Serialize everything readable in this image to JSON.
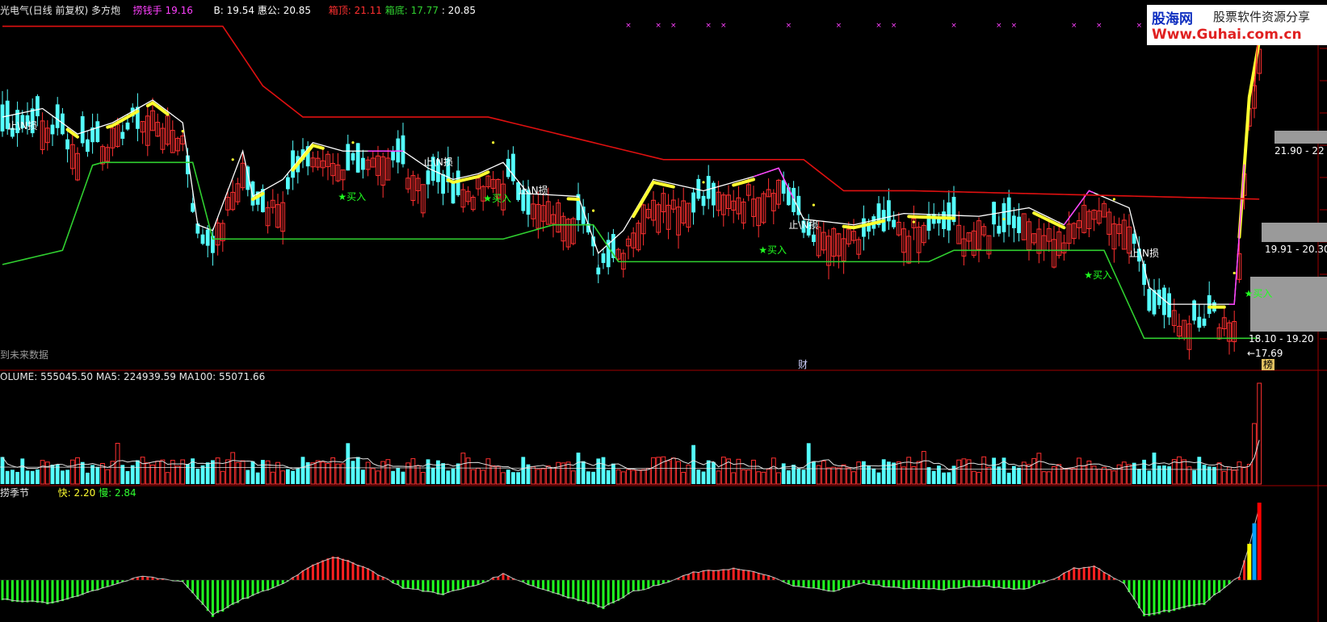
{
  "header": {
    "stock_name": "光电气(日线 前复权) 多方炮",
    "lao_label": "捞钱手",
    "lao_value": "19.16",
    "b_label": "B:",
    "b_value": "19.54",
    "hui_label": "惠公:",
    "hui_value": "20.85",
    "xd_label": "箱顶:",
    "xd_value": "21.11",
    "xdi_label": "箱底:",
    "xdi_value": "17.77",
    "extra_value": ": 20.85"
  },
  "logo": {
    "cn_name": "股海网",
    "slogan": "股票软件资源分享",
    "url": "Www.Guhai.com.cn"
  },
  "main_chart": {
    "future_note": "到未来数据",
    "cai_marker": "财",
    "bang_marker": "榜",
    "zone_upper": "21.90 - 22",
    "zone_mid": "19.91 - 20.30",
    "zone_lower": "18.10 - 19.20",
    "low_marker": "←17.69",
    "signals": [
      {
        "text": "止\\N损",
        "i": 1,
        "price": 21.7,
        "color": "#ffffff"
      },
      {
        "text": "止\\N损",
        "i": 84,
        "price": 21.05,
        "color": "#ffffff"
      },
      {
        "text": "止\\N损",
        "i": 103,
        "price": 20.55,
        "color": "#ffffff"
      },
      {
        "text": "止\\N损",
        "i": 157,
        "price": 19.95,
        "color": "#ffffff"
      },
      {
        "text": "止\\N损",
        "i": 225,
        "price": 19.45,
        "color": "#ffffff"
      },
      {
        "text": "★买入",
        "i": 67,
        "price": 20.45,
        "color": "#20ff20"
      },
      {
        "text": "★买入",
        "i": 96,
        "price": 20.42,
        "color": "#20ff20"
      },
      {
        "text": "★买入",
        "i": 151,
        "price": 19.5,
        "color": "#20ff20"
      },
      {
        "text": "★买入",
        "i": 216,
        "price": 19.07,
        "color": "#20ff20"
      },
      {
        "text": "★买入",
        "i": 248,
        "price": 18.73,
        "color": "#20ff20"
      }
    ]
  },
  "volume_panel": {
    "label": "OLUME:",
    "value": "555045.50",
    "ma5_label": "MA5:",
    "ma5_value": "224939.59",
    "ma100_label": "MA100:",
    "ma100_value": "55071.66"
  },
  "season_panel": {
    "name": "捞季节",
    "fast_label": "快:",
    "fast_value": "2.20",
    "slow_label": "慢:",
    "slow_value": "2.84"
  },
  "colors": {
    "up": "#ff3030",
    "down": "#54ffff",
    "box_top": "#e01010",
    "box_bottom": "#30d030",
    "yellow": "#ffff30",
    "magenta": "#ff40ff",
    "white": "#ffffff",
    "frame": "#a00000"
  },
  "chart_data": {
    "type": "candlestick",
    "price_range": [
      17.4,
      23.6
    ],
    "candles": {
      "anchors": [
        [
          0,
          21.6
        ],
        [
          8,
          21.75
        ],
        [
          15,
          21.3
        ],
        [
          22,
          21.5
        ],
        [
          30,
          21.9
        ],
        [
          36,
          21.5
        ],
        [
          39,
          19.7
        ],
        [
          42,
          19.6
        ],
        [
          48,
          21.0
        ],
        [
          50,
          20.2
        ],
        [
          56,
          20.5
        ],
        [
          62,
          21.15
        ],
        [
          68,
          21.0
        ],
        [
          80,
          21.0
        ],
        [
          85,
          20.7
        ],
        [
          90,
          20.5
        ],
        [
          95,
          20.6
        ],
        [
          100,
          20.8
        ],
        [
          105,
          20.25
        ],
        [
          115,
          20.2
        ],
        [
          119,
          19.2
        ],
        [
          124,
          19.6
        ],
        [
          130,
          20.5
        ],
        [
          140,
          20.3
        ],
        [
          150,
          20.55
        ],
        [
          155,
          20.7
        ],
        [
          160,
          19.8
        ],
        [
          170,
          19.7
        ],
        [
          180,
          19.9
        ],
        [
          195,
          19.85
        ],
        [
          205,
          20.0
        ],
        [
          212,
          19.7
        ],
        [
          217,
          20.3
        ],
        [
          225,
          20.0
        ],
        [
          229,
          18.6
        ],
        [
          233,
          18.3
        ],
        [
          240,
          18.3
        ],
        [
          246,
          18.3
        ],
        [
          249,
          22.0
        ],
        [
          251,
          23.0
        ]
      ],
      "down_ranges": [
        [
          0,
          7
        ],
        [
          10,
          13
        ],
        [
          16,
          19
        ],
        [
          24,
          27
        ],
        [
          37,
          42
        ],
        [
          49,
          52
        ],
        [
          57,
          61
        ],
        [
          69,
          72
        ],
        [
          78,
          80
        ],
        [
          85,
          91
        ],
        [
          101,
          105
        ],
        [
          115,
          122
        ],
        [
          138,
          142
        ],
        [
          156,
          162
        ],
        [
          172,
          178
        ],
        [
          185,
          190
        ],
        [
          198,
          203
        ],
        [
          226,
          233
        ],
        [
          238,
          242
        ]
      ],
      "seed": 7
    },
    "box_top": [
      [
        0,
        23.45
      ],
      [
        44,
        23.45
      ],
      [
        52,
        22.4
      ],
      [
        60,
        21.85
      ],
      [
        97,
        21.85
      ],
      [
        132,
        21.1
      ],
      [
        160,
        21.1
      ],
      [
        168,
        20.55
      ],
      [
        182,
        20.55
      ],
      [
        252,
        20.4
      ]
    ],
    "box_bottom": [
      [
        0,
        19.25
      ],
      [
        12,
        19.5
      ],
      [
        18,
        21.0
      ],
      [
        20,
        21.05
      ],
      [
        38,
        21.05
      ],
      [
        42,
        19.7
      ],
      [
        100,
        19.7
      ],
      [
        110,
        19.95
      ],
      [
        118,
        19.95
      ],
      [
        123,
        19.3
      ],
      [
        185,
        19.3
      ],
      [
        190,
        19.5
      ],
      [
        220,
        19.5
      ],
      [
        228,
        17.95
      ],
      [
        252,
        17.95
      ]
    ],
    "volume": {
      "ma100_level": 55071.66,
      "last_value": 555045.5,
      "ma5_last": 224939.59
    },
    "season": {
      "fast_last": 2.2,
      "slow_last": 2.84
    }
  }
}
